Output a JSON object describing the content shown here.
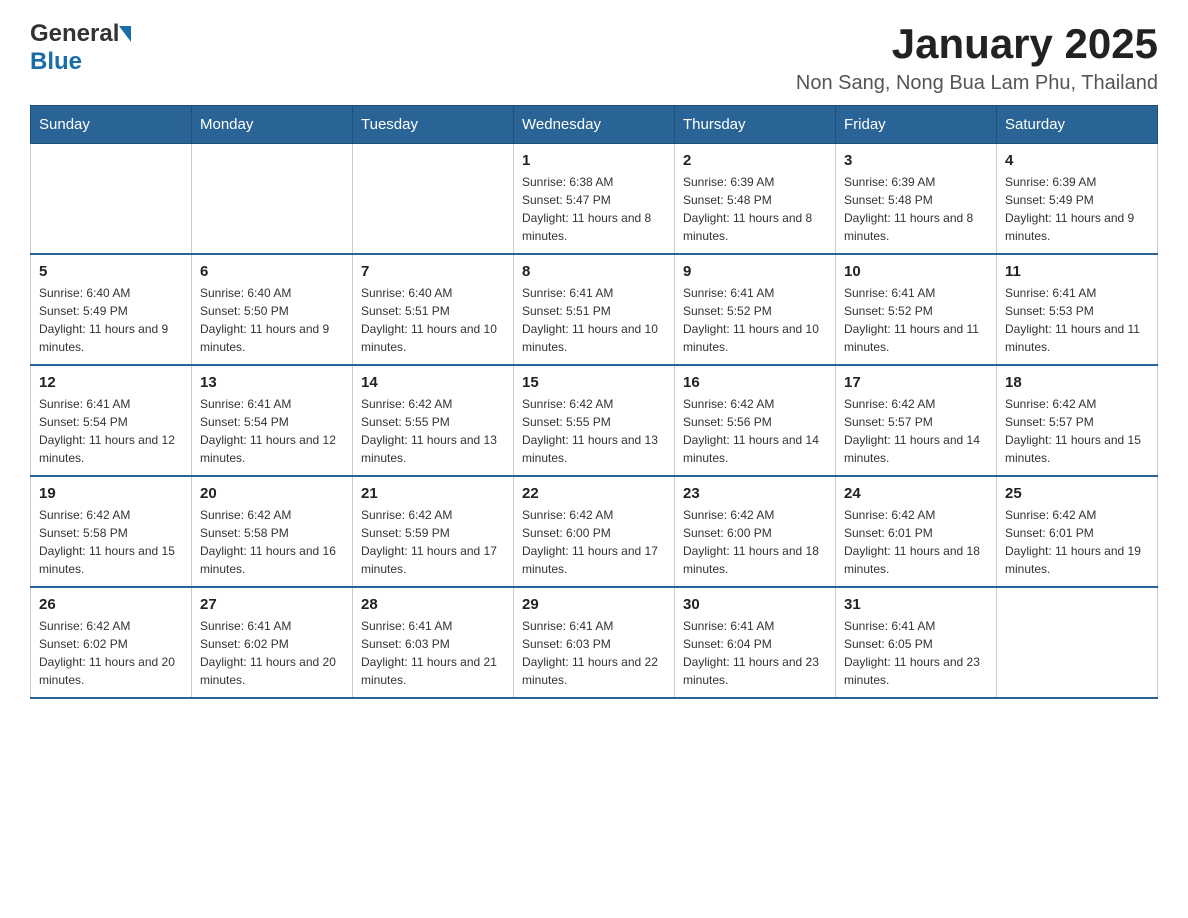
{
  "header": {
    "logo_general": "General",
    "logo_blue": "Blue",
    "title": "January 2025",
    "subtitle": "Non Sang, Nong Bua Lam Phu, Thailand"
  },
  "calendar": {
    "days_of_week": [
      "Sunday",
      "Monday",
      "Tuesday",
      "Wednesday",
      "Thursday",
      "Friday",
      "Saturday"
    ],
    "weeks": [
      [
        {
          "day": "",
          "info": ""
        },
        {
          "day": "",
          "info": ""
        },
        {
          "day": "",
          "info": ""
        },
        {
          "day": "1",
          "info": "Sunrise: 6:38 AM\nSunset: 5:47 PM\nDaylight: 11 hours and 8 minutes."
        },
        {
          "day": "2",
          "info": "Sunrise: 6:39 AM\nSunset: 5:48 PM\nDaylight: 11 hours and 8 minutes."
        },
        {
          "day": "3",
          "info": "Sunrise: 6:39 AM\nSunset: 5:48 PM\nDaylight: 11 hours and 8 minutes."
        },
        {
          "day": "4",
          "info": "Sunrise: 6:39 AM\nSunset: 5:49 PM\nDaylight: 11 hours and 9 minutes."
        }
      ],
      [
        {
          "day": "5",
          "info": "Sunrise: 6:40 AM\nSunset: 5:49 PM\nDaylight: 11 hours and 9 minutes."
        },
        {
          "day": "6",
          "info": "Sunrise: 6:40 AM\nSunset: 5:50 PM\nDaylight: 11 hours and 9 minutes."
        },
        {
          "day": "7",
          "info": "Sunrise: 6:40 AM\nSunset: 5:51 PM\nDaylight: 11 hours and 10 minutes."
        },
        {
          "day": "8",
          "info": "Sunrise: 6:41 AM\nSunset: 5:51 PM\nDaylight: 11 hours and 10 minutes."
        },
        {
          "day": "9",
          "info": "Sunrise: 6:41 AM\nSunset: 5:52 PM\nDaylight: 11 hours and 10 minutes."
        },
        {
          "day": "10",
          "info": "Sunrise: 6:41 AM\nSunset: 5:52 PM\nDaylight: 11 hours and 11 minutes."
        },
        {
          "day": "11",
          "info": "Sunrise: 6:41 AM\nSunset: 5:53 PM\nDaylight: 11 hours and 11 minutes."
        }
      ],
      [
        {
          "day": "12",
          "info": "Sunrise: 6:41 AM\nSunset: 5:54 PM\nDaylight: 11 hours and 12 minutes."
        },
        {
          "day": "13",
          "info": "Sunrise: 6:41 AM\nSunset: 5:54 PM\nDaylight: 11 hours and 12 minutes."
        },
        {
          "day": "14",
          "info": "Sunrise: 6:42 AM\nSunset: 5:55 PM\nDaylight: 11 hours and 13 minutes."
        },
        {
          "day": "15",
          "info": "Sunrise: 6:42 AM\nSunset: 5:55 PM\nDaylight: 11 hours and 13 minutes."
        },
        {
          "day": "16",
          "info": "Sunrise: 6:42 AM\nSunset: 5:56 PM\nDaylight: 11 hours and 14 minutes."
        },
        {
          "day": "17",
          "info": "Sunrise: 6:42 AM\nSunset: 5:57 PM\nDaylight: 11 hours and 14 minutes."
        },
        {
          "day": "18",
          "info": "Sunrise: 6:42 AM\nSunset: 5:57 PM\nDaylight: 11 hours and 15 minutes."
        }
      ],
      [
        {
          "day": "19",
          "info": "Sunrise: 6:42 AM\nSunset: 5:58 PM\nDaylight: 11 hours and 15 minutes."
        },
        {
          "day": "20",
          "info": "Sunrise: 6:42 AM\nSunset: 5:58 PM\nDaylight: 11 hours and 16 minutes."
        },
        {
          "day": "21",
          "info": "Sunrise: 6:42 AM\nSunset: 5:59 PM\nDaylight: 11 hours and 17 minutes."
        },
        {
          "day": "22",
          "info": "Sunrise: 6:42 AM\nSunset: 6:00 PM\nDaylight: 11 hours and 17 minutes."
        },
        {
          "day": "23",
          "info": "Sunrise: 6:42 AM\nSunset: 6:00 PM\nDaylight: 11 hours and 18 minutes."
        },
        {
          "day": "24",
          "info": "Sunrise: 6:42 AM\nSunset: 6:01 PM\nDaylight: 11 hours and 18 minutes."
        },
        {
          "day": "25",
          "info": "Sunrise: 6:42 AM\nSunset: 6:01 PM\nDaylight: 11 hours and 19 minutes."
        }
      ],
      [
        {
          "day": "26",
          "info": "Sunrise: 6:42 AM\nSunset: 6:02 PM\nDaylight: 11 hours and 20 minutes."
        },
        {
          "day": "27",
          "info": "Sunrise: 6:41 AM\nSunset: 6:02 PM\nDaylight: 11 hours and 20 minutes."
        },
        {
          "day": "28",
          "info": "Sunrise: 6:41 AM\nSunset: 6:03 PM\nDaylight: 11 hours and 21 minutes."
        },
        {
          "day": "29",
          "info": "Sunrise: 6:41 AM\nSunset: 6:03 PM\nDaylight: 11 hours and 22 minutes."
        },
        {
          "day": "30",
          "info": "Sunrise: 6:41 AM\nSunset: 6:04 PM\nDaylight: 11 hours and 23 minutes."
        },
        {
          "day": "31",
          "info": "Sunrise: 6:41 AM\nSunset: 6:05 PM\nDaylight: 11 hours and 23 minutes."
        },
        {
          "day": "",
          "info": ""
        }
      ]
    ]
  }
}
